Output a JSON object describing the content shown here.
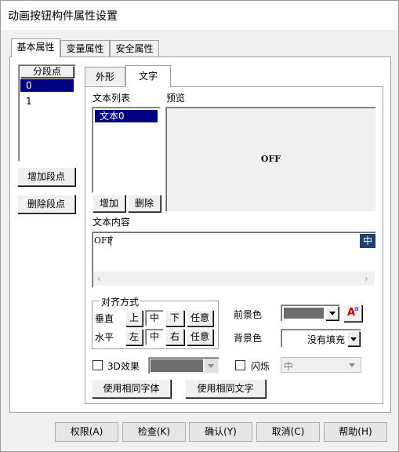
{
  "window": {
    "title": "动画按钮构件属性设置"
  },
  "tabs": [
    "基本属性",
    "变量属性",
    "安全属性"
  ],
  "segment": {
    "header": "分段点",
    "items": [
      "0",
      "1"
    ],
    "add_button": "增加段点",
    "delete_button": "删除段点"
  },
  "subtabs": [
    "外形",
    "文字"
  ],
  "text_list": {
    "label": "文本列表",
    "items": [
      "文本0"
    ],
    "add_button": "增加",
    "delete_button": "删除"
  },
  "preview": {
    "label": "预览",
    "text": "OFF"
  },
  "text_content": {
    "label": "文本内容",
    "value": "OFF",
    "ime_glyph": "中"
  },
  "alignment": {
    "legend": "对齐方式",
    "vertical_label": "垂直",
    "horizontal_label": "水平",
    "vertical_options": [
      "上",
      "中",
      "下",
      "任意"
    ],
    "horizontal_options": [
      "左",
      "中",
      "右",
      "任意"
    ]
  },
  "colors": {
    "foreground_label": "前景色",
    "foreground_value": "#6d6d6d",
    "background_label": "背景色",
    "background_value": "没有填充",
    "font_glyph": "A",
    "font_glyph_sup": "a"
  },
  "effects": {
    "effect3d_label": "3D效果",
    "effect3d_color": "#6d6d6d",
    "blink_label": "闪烁",
    "blink_value": "中"
  },
  "same_buttons": {
    "same_font": "使用相同字体",
    "same_text": "使用相同文字"
  },
  "footer": {
    "permission": "权限(A)",
    "check": "检查(K)",
    "confirm": "确认(Y)",
    "cancel": "取消(C)",
    "help": "帮助(H)"
  }
}
